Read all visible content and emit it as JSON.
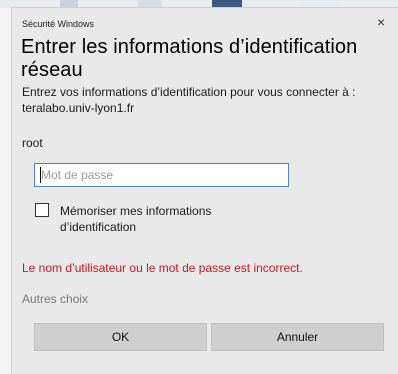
{
  "dialog": {
    "window_title": "Sécurité Windows",
    "close_glyph": "×",
    "heading": "Entrer les informations d’identification réseau",
    "description": "Entrez vos informations d’identification pour vous connecter à : teralabo.univ-lyon1.fr",
    "username": "root",
    "password": {
      "value": "",
      "placeholder": "Mot de passe"
    },
    "remember_label": "Mémoriser mes informations d’identification",
    "remember_checked": false,
    "error_message": "Le nom d’utilisateur ou le mot de passe est incorrect.",
    "more_choices": "Autres choix",
    "ok_label": "OK",
    "cancel_label": "Annuler"
  },
  "colors": {
    "dialog_bg": "#e9e9e9",
    "input_border": "#4b86c5",
    "error": "#c8191d",
    "button_bg": "#cfcfcf"
  },
  "icons": [
    "close-icon"
  ]
}
